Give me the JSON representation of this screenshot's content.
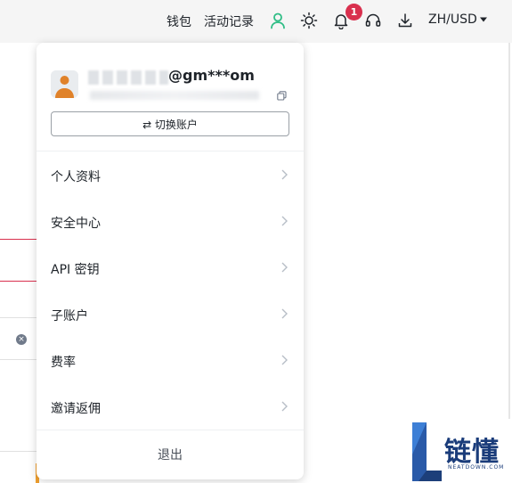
{
  "topbar": {
    "wallet_label": "钱包",
    "activity_label": "活动记录",
    "notification_count": "1",
    "locale_label": "ZH/USD"
  },
  "account": {
    "email_visible": "@gm***om",
    "switch_label": "⇄ 切换账户"
  },
  "menu": [
    {
      "label": "个人资料"
    },
    {
      "label": "安全中心"
    },
    {
      "label": "API 密钥"
    },
    {
      "label": "子账户"
    },
    {
      "label": "费率"
    },
    {
      "label": "邀请返佣"
    }
  ],
  "logout_label": "退出",
  "watermark": {
    "text": "链懂",
    "sub": "NEATDOWN.COM"
  },
  "colors": {
    "accent_green": "#2ebd85",
    "badge_red": "#d9304e",
    "brand_blue": "#1a3c7a"
  }
}
